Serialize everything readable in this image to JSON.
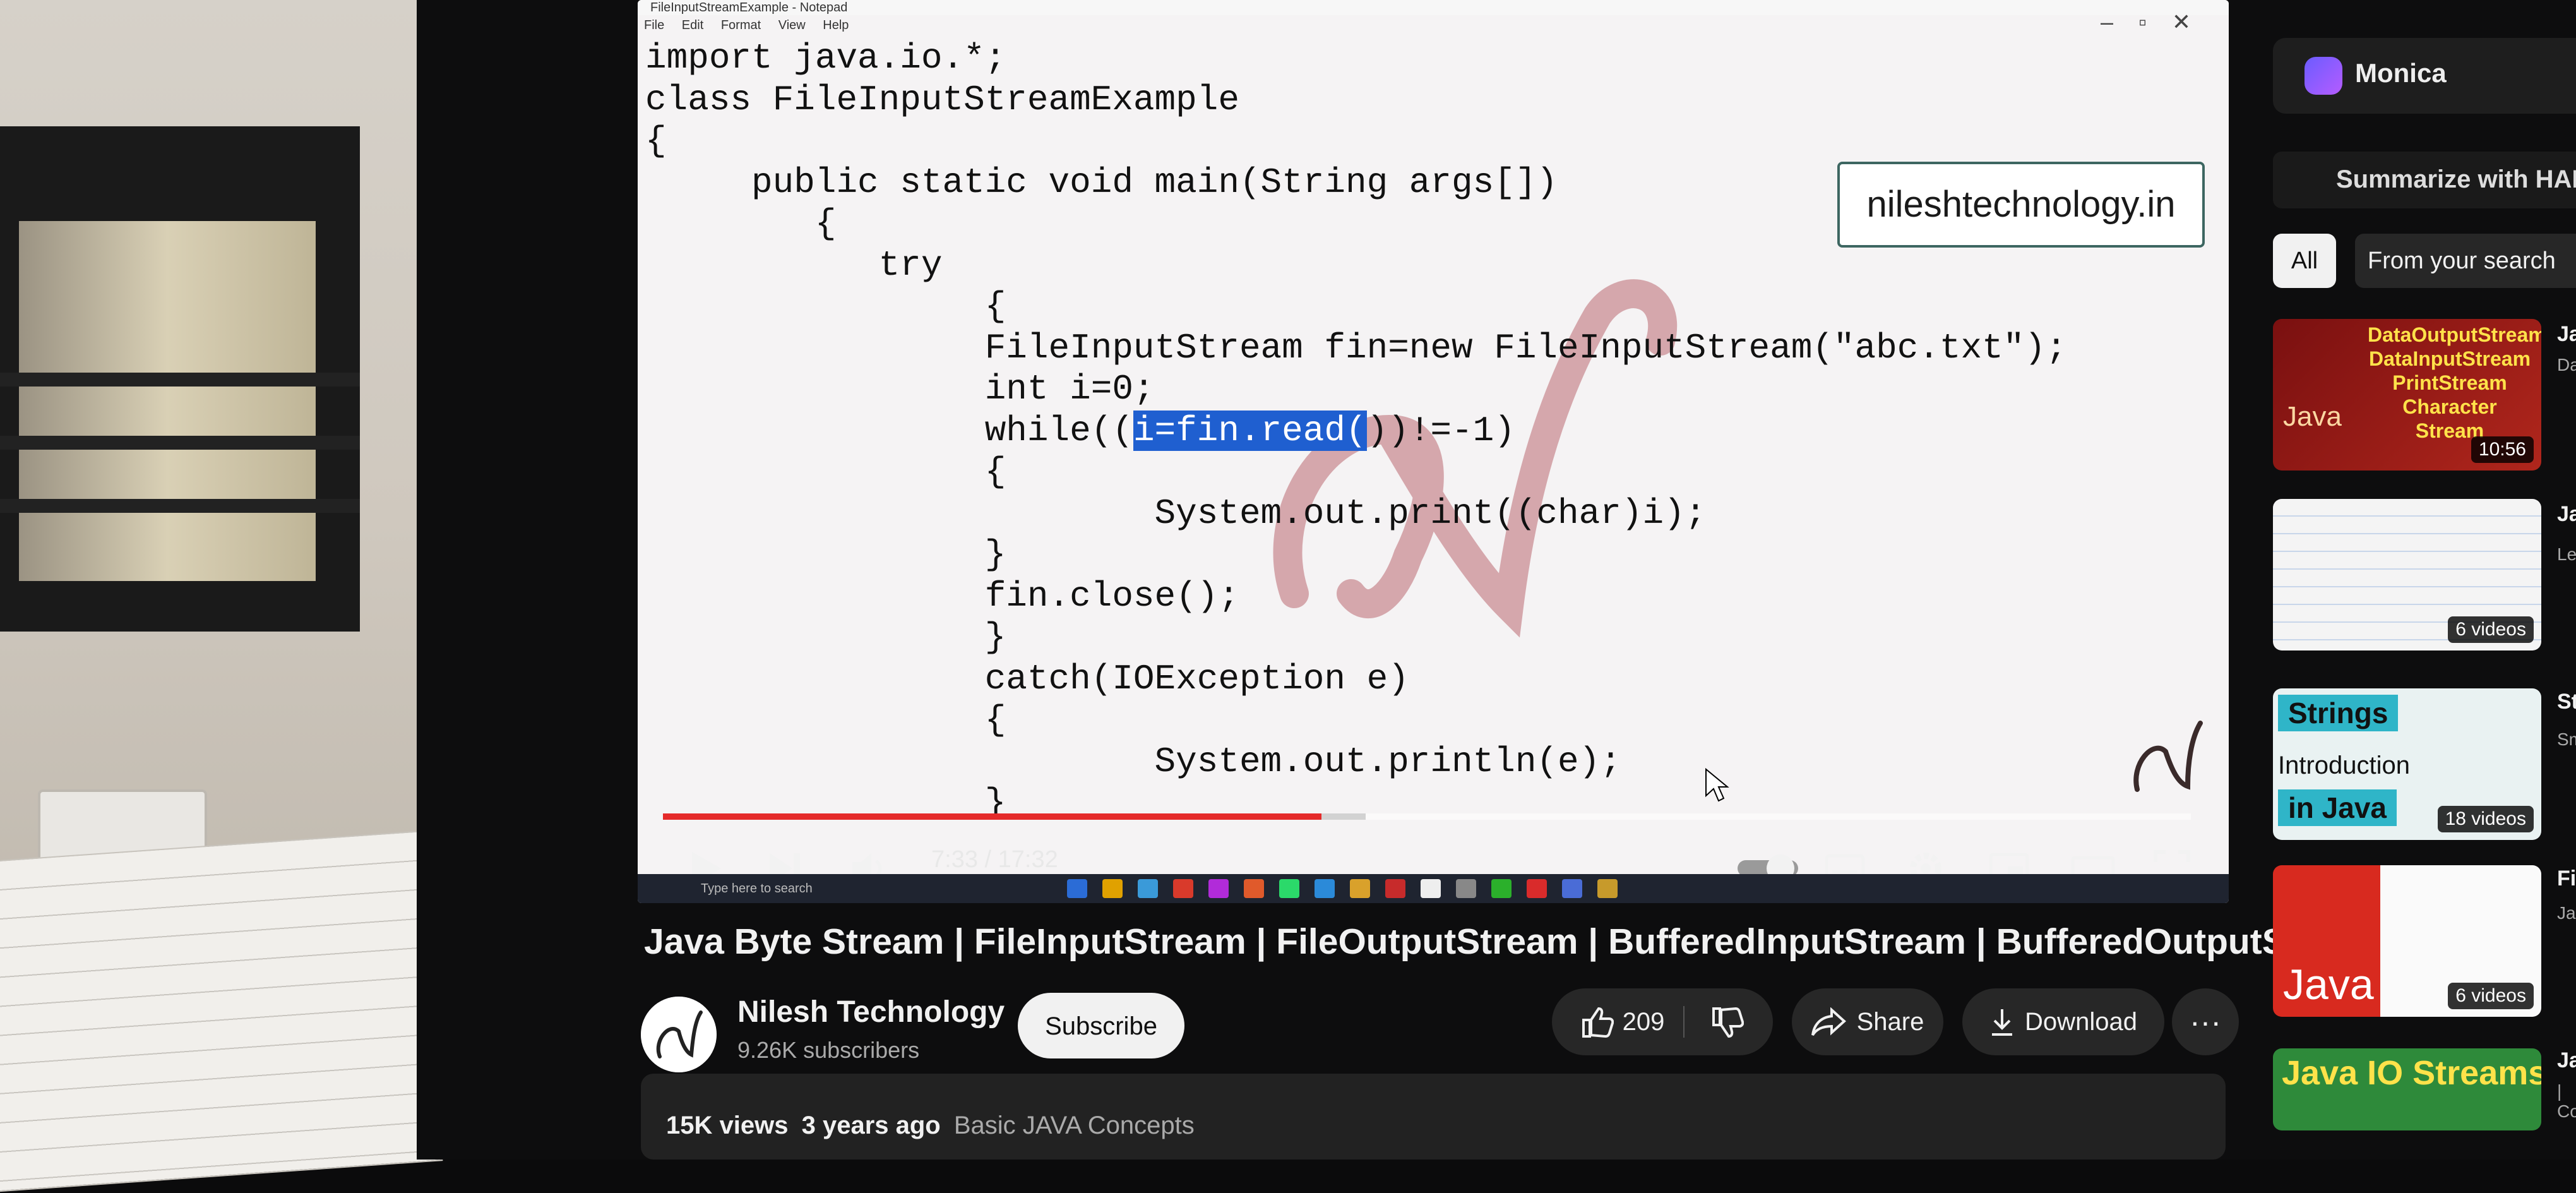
{
  "notepad": {
    "window_title": "FileInputStreamExample - Notepad",
    "menu": [
      "File",
      "Edit",
      "Format",
      "View",
      "Help"
    ],
    "code_lines": [
      "import java.io.*;",
      "class FileInputStreamExample",
      "{",
      "     public static void main(String args[])",
      "        {",
      "           try",
      "                {",
      "                FileInputStream fin=new FileInputStream(\"abc.txt\");",
      "                int i=0;",
      "                while((",
      "                {",
      "                        System.out.print((char)i);",
      "                }",
      "                fin.close();",
      "                }",
      "                catch(IOException e)",
      "                {",
      "                        System.out.println(e);",
      "                }"
    ],
    "highlighted_text": "i=fin.read(",
    "after_highlight": "))!=-1)",
    "site": "nileshtechnology.in"
  },
  "player": {
    "time": "7:33 / 17:32",
    "progress": 0.431,
    "buffered": 0.46,
    "taskbar_search": "Type here to search"
  },
  "video": {
    "title": "Java Byte Stream | FileInputStream | FileOutputStream | BufferedInputStream | BufferedOutputStream",
    "channel": "Nilesh Technology",
    "subscribers": "9.26K subscribers",
    "subscribe_label": "Subscribe",
    "likes": "209",
    "share_label": "Share",
    "download_label": "Download",
    "views": "15K views",
    "age": "3 years ago",
    "tag": "Basic JAVA Concepts"
  },
  "sidebar": {
    "monica": "Monica",
    "harpa": "Summarize with HARPA",
    "chips": [
      "All",
      "From your search"
    ],
    "items": [
      {
        "thumb_lines": [
          "DataOutputStream",
          "DataInputStream",
          "PrintStream",
          "Character Stream"
        ],
        "thumb_brand": "Java",
        "badge": "10:56",
        "title_peek": "Ja",
        "sub_peek": "Da"
      },
      {
        "badge": "6 videos",
        "title_peek": "Ja",
        "sub_peek": "Le"
      },
      {
        "thumb_lines": [
          "Strings",
          "Introduction",
          "in Java"
        ],
        "badge": "18 videos",
        "title_peek": "Sti",
        "sub_peek": "Sm"
      },
      {
        "thumb_brand": "Java",
        "badge": "6 videos",
        "title_peek": "File",
        "sub_peek": "Ja"
      },
      {
        "thumb_lines": [
          "Java IO Streams"
        ],
        "title_peek": "Jav",
        "sub_peek": "| Co"
      }
    ]
  },
  "colors": {
    "progress": "#e52a2a",
    "highlight": "#1f5fd0",
    "background": "#0f0f0f",
    "pill": "#272727"
  }
}
